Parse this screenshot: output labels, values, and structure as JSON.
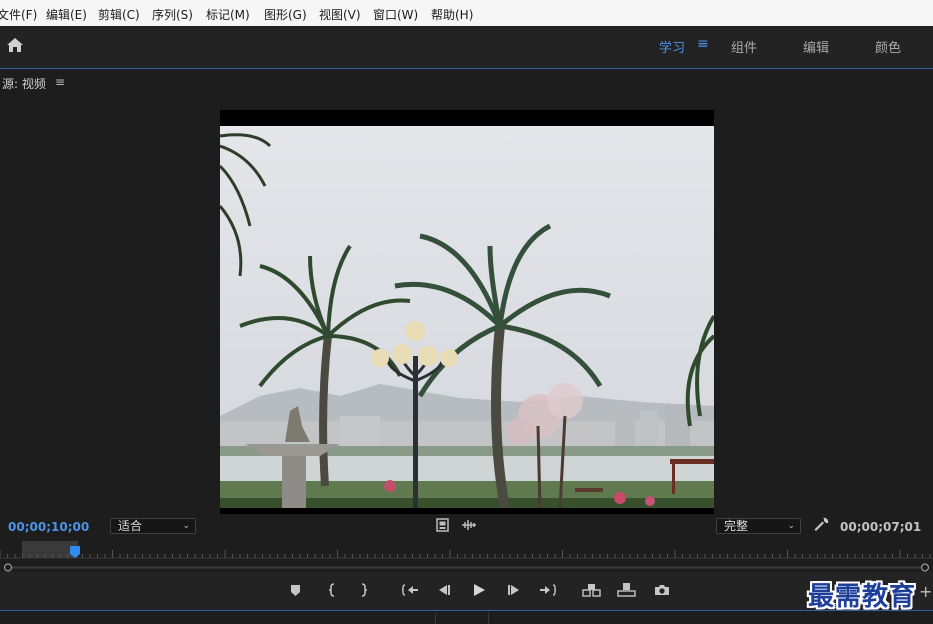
{
  "menu": [
    "文件(F)",
    "编辑(E)",
    "剪辑(C)",
    "序列(S)",
    "标记(M)",
    "图形(G)",
    "视图(V)",
    "窗口(W)",
    "帮助(H)"
  ],
  "workspaces": {
    "learn": "学习",
    "assembly": "组件",
    "editing": "编辑",
    "color": "颜色"
  },
  "panel": {
    "title": "源: 视频",
    "menu_icon": "hamburger-icon"
  },
  "source_monitor": {
    "current_timecode": "00;00;10;00",
    "duration_timecode": "00;00;07;01",
    "zoom_select": "适合",
    "resolution_select": "完整"
  },
  "controls": [
    "add-marker-icon",
    "mark-in-icon",
    "mark-out-icon",
    "go-to-in-icon",
    "step-back-icon",
    "play-icon",
    "step-forward-icon",
    "go-to-out-icon",
    "insert-icon",
    "overwrite-icon",
    "export-frame-icon"
  ],
  "watermark": "最需教育",
  "colors": {
    "accent": "#4d93e8",
    "panel_bg": "#1d1d1d",
    "menubar_bg": "#f6f6f6"
  }
}
